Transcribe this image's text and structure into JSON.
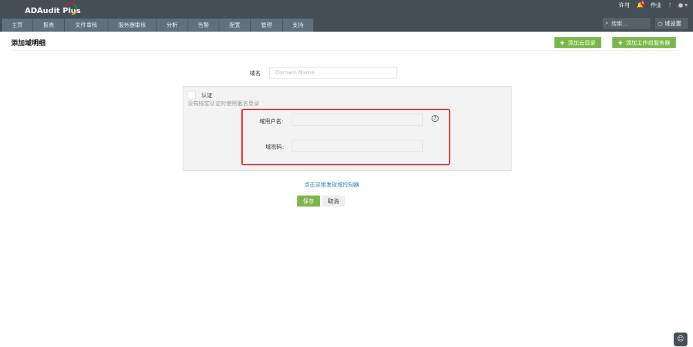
{
  "app": {
    "name": "ADAudit Plus"
  },
  "nav": [
    "主页",
    "报表",
    "文件审核",
    "服务器审核",
    "分析",
    "告警",
    "配置",
    "管理",
    "支持"
  ],
  "topbar": {
    "license": "许可",
    "notif_count": "5",
    "jobs": "作业",
    "help": "?",
    "search_placeholder": "搜索...",
    "domain_settings": "域设置"
  },
  "page": {
    "title": "添加域明细",
    "add_cloud": "添加云目录",
    "add_workgroup": "添加工作组服务器"
  },
  "form": {
    "domain_label": "域名",
    "domain_placeholder": "Domain Name",
    "auth_label": "认证",
    "auth_hint": "没有指定认证时使用匿名登录",
    "user_label": "域用户名:",
    "pass_label": "域密码:",
    "discover_link": "点击这里发现域控制器",
    "save": "保存",
    "cancel": "取消"
  },
  "colors": {
    "accent": "#7ab648",
    "header": "#434e57",
    "highlight": "#e52222"
  }
}
